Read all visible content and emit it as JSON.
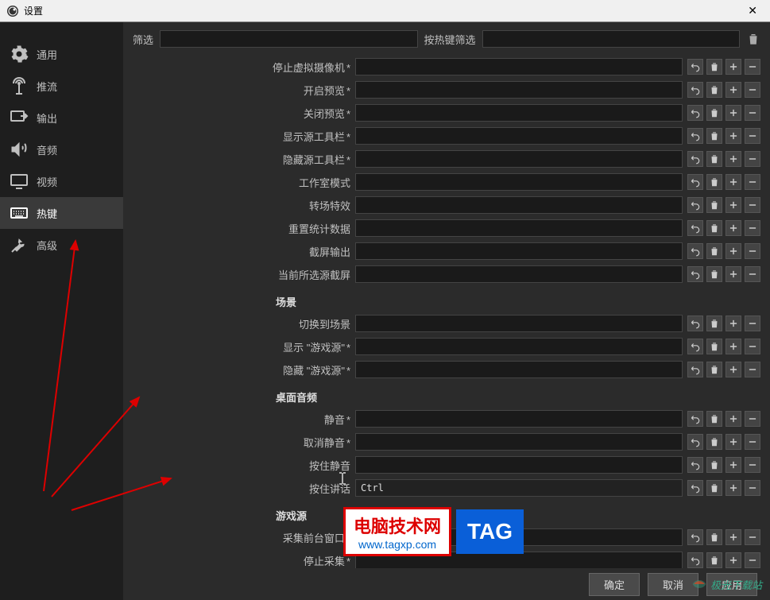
{
  "window": {
    "title": "设置"
  },
  "sidebar": {
    "items": [
      {
        "id": "general",
        "label": "通用"
      },
      {
        "id": "stream",
        "label": "推流"
      },
      {
        "id": "output",
        "label": "输出"
      },
      {
        "id": "audio",
        "label": "音频"
      },
      {
        "id": "video",
        "label": "视频"
      },
      {
        "id": "hotkeys",
        "label": "热键"
      },
      {
        "id": "advanced",
        "label": "高级"
      }
    ],
    "active": "hotkeys"
  },
  "filters": {
    "filter_label": "筛选",
    "filter_value": "",
    "hotkey_filter_label": "按热键筛选",
    "hotkey_filter_value": ""
  },
  "hotkeys_top": [
    {
      "label": "停止虚拟摄像机",
      "ast": "*",
      "value": ""
    },
    {
      "label": "开启预览",
      "ast": "*",
      "value": ""
    },
    {
      "label": "关闭预览",
      "ast": "*",
      "value": ""
    },
    {
      "label": "显示源工具栏",
      "ast": "*",
      "value": ""
    },
    {
      "label": "隐藏源工具栏",
      "ast": "*",
      "value": ""
    },
    {
      "label": "工作室模式",
      "ast": "",
      "value": ""
    },
    {
      "label": "转场特效",
      "ast": "",
      "value": ""
    },
    {
      "label": "重置统计数据",
      "ast": "",
      "value": ""
    },
    {
      "label": "截屏输出",
      "ast": "",
      "value": ""
    },
    {
      "label": "当前所选源截屏",
      "ast": "",
      "value": ""
    }
  ],
  "sections": {
    "scene": {
      "title": "场景",
      "rows": [
        {
          "label": "切换到场景",
          "ast": "",
          "value": ""
        },
        {
          "label": "显示 \"游戏源\"",
          "ast": "*",
          "value": ""
        },
        {
          "label": "隐藏 \"游戏源\"",
          "ast": "*",
          "value": ""
        }
      ]
    },
    "desktop_audio": {
      "title": "桌面音频",
      "rows": [
        {
          "label": "静音",
          "ast": "*",
          "value": ""
        },
        {
          "label": "取消静音",
          "ast": "*",
          "value": ""
        },
        {
          "label": "按住静音",
          "ast": "",
          "value": ""
        },
        {
          "label": "按住讲话",
          "ast": "",
          "value": "Ctrl",
          "focused": true
        }
      ]
    },
    "game_source": {
      "title": "游戏源",
      "rows": [
        {
          "label": "采集前台窗口",
          "ast": "*",
          "value": ""
        },
        {
          "label": "停止采集",
          "ast": "*",
          "value": ""
        }
      ]
    }
  },
  "footer": {
    "ok": "确定",
    "cancel": "取消",
    "apply": "应用"
  },
  "overlays": {
    "logo1_line1": "电脑技术网",
    "logo1_line2": "www.tagxp.com",
    "logo1_tag": "TAG",
    "watermark": "极光下载站"
  }
}
